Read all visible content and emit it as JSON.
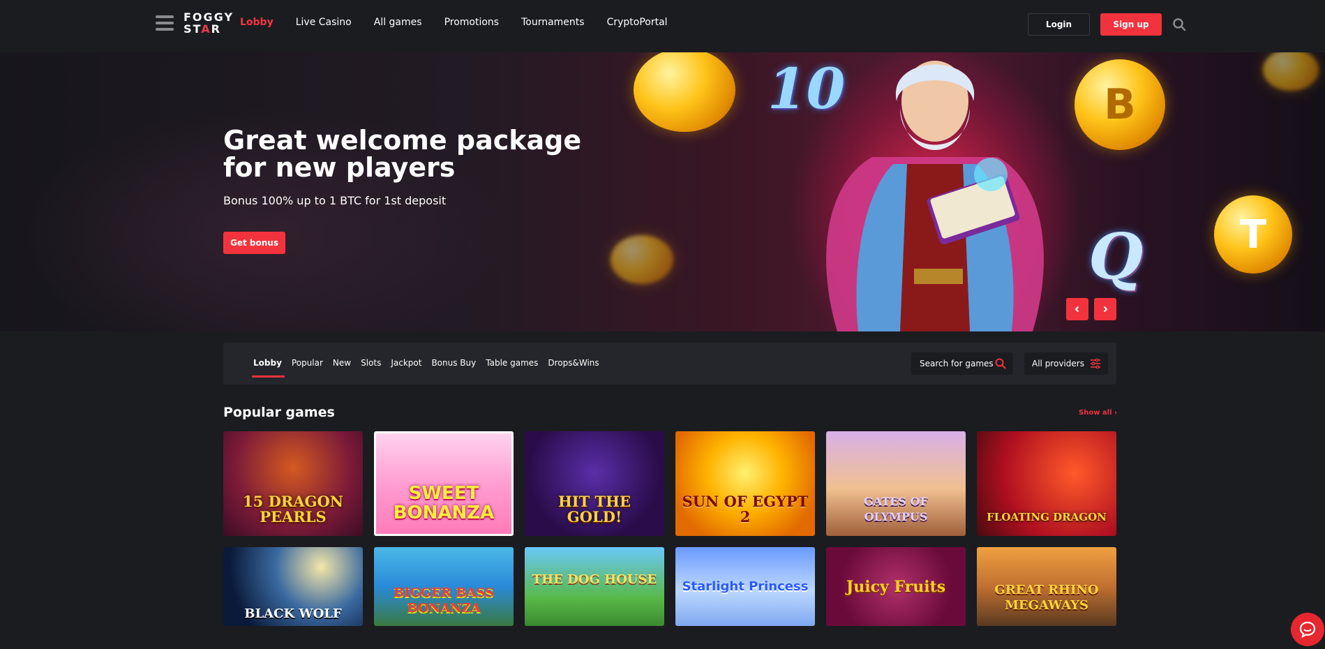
{
  "header": {
    "logo_line1": "FOGGY",
    "logo_line2_a": "ST",
    "logo_line2_star": "A",
    "logo_line2_b": "R",
    "nav": [
      "Lobby",
      "Live Casino",
      "All games",
      "Promotions",
      "Tournaments",
      "CryptoPortal"
    ],
    "active_nav": "Lobby",
    "login_label": "Login",
    "signup_label": "Sign up",
    "search_icon": "search-icon",
    "menu_icon": "hamburger-menu-icon"
  },
  "hero": {
    "title": "Great welcome package for new players",
    "subtitle": "Bonus 100% up to 1 BTC for 1st deposit",
    "cta_label": "Get bonus",
    "coin_symbols": [
      "B",
      "T",
      "10",
      "Q"
    ],
    "prev_icon": "chevron-left-icon",
    "next_icon": "chevron-right-icon"
  },
  "filters": {
    "tabs": [
      "Lobby",
      "Popular",
      "New",
      "Slots",
      "Jackpot",
      "Bonus Buy",
      "Table games",
      "Drops&Wins"
    ],
    "active_tab": "Lobby",
    "search_label": "Search for games",
    "providers_label": "All providers"
  },
  "section": {
    "title": "Popular games",
    "show_all": "Show all"
  },
  "games": [
    {
      "name": "15 Dragon Pearls"
    },
    {
      "name": "Sweet Bonanza"
    },
    {
      "name": "Hit the Gold!"
    },
    {
      "name": "Sun of Egypt 2"
    },
    {
      "name": "Gates of Olympus"
    },
    {
      "name": "Floating Dragon"
    },
    {
      "name": "Black Wolf"
    },
    {
      "name": "Bigger Bass Bonanza"
    },
    {
      "name": "The Dog House"
    },
    {
      "name": "Starlight Princess"
    },
    {
      "name": "Juicy Fruits"
    },
    {
      "name": "Great Rhino Megaways"
    }
  ],
  "colors": {
    "accent": "#f2333d",
    "background": "#1b1c20",
    "panel": "#25262b"
  },
  "chat_icon": "chat-bubble-icon"
}
